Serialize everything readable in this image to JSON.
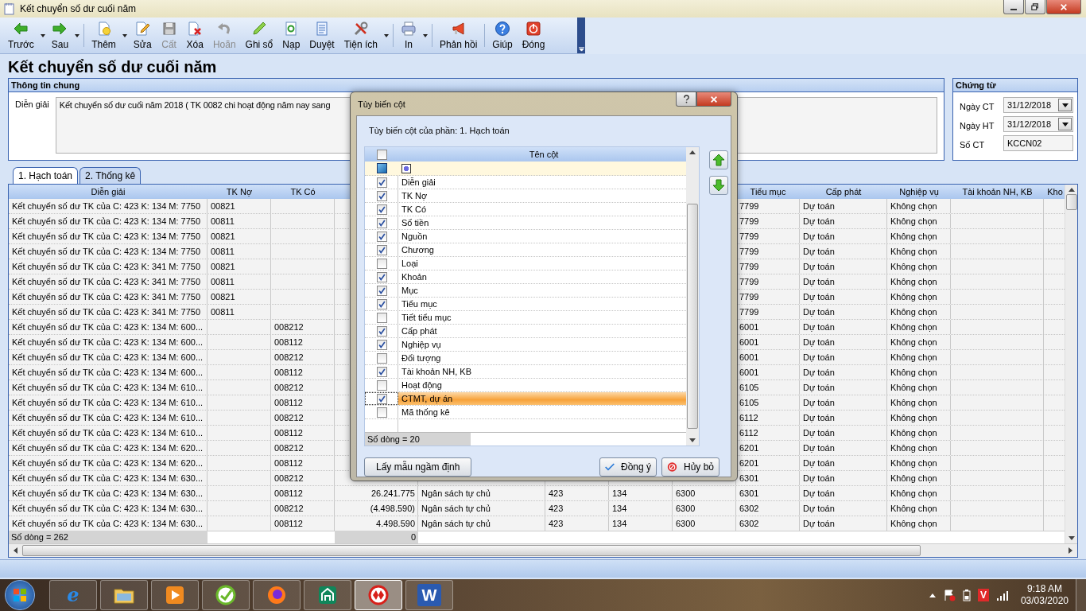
{
  "window": {
    "title": "Kết chuyển số dư cuối năm"
  },
  "toolbar": [
    [
      {
        "label": "Trước",
        "kind": "prev",
        "dropdown": true,
        "disabled": false
      },
      {
        "label": "Sau",
        "kind": "next",
        "dropdown": true,
        "disabled": false
      }
    ],
    [
      {
        "label": "Thêm",
        "kind": "add",
        "dropdown": true,
        "disabled": false
      },
      {
        "label": "Sửa",
        "kind": "edit",
        "dropdown": false,
        "disabled": false
      },
      {
        "label": "Cất",
        "kind": "save",
        "dropdown": false,
        "disabled": true
      },
      {
        "label": "Xóa",
        "kind": "delete",
        "dropdown": false,
        "disabled": false
      },
      {
        "label": "Hoãn",
        "kind": "undo",
        "dropdown": false,
        "disabled": true
      },
      {
        "label": "Ghi sổ",
        "kind": "post",
        "dropdown": false,
        "disabled": false
      },
      {
        "label": "Nạp",
        "kind": "reload",
        "dropdown": false,
        "disabled": false
      },
      {
        "label": "Duyệt",
        "kind": "approve",
        "dropdown": false,
        "disabled": false
      },
      {
        "label": "Tiện ích",
        "kind": "tools",
        "dropdown": true,
        "disabled": false
      }
    ],
    [
      {
        "label": "In",
        "kind": "print",
        "dropdown": true,
        "disabled": false
      }
    ],
    [
      {
        "label": "Phản hồi",
        "kind": "feedback",
        "dropdown": false,
        "disabled": false
      }
    ],
    [
      {
        "label": "Giúp",
        "kind": "help",
        "dropdown": false,
        "disabled": false
      },
      {
        "label": "Đóng",
        "kind": "close",
        "dropdown": false,
        "disabled": false
      }
    ]
  ],
  "page_title": "Kết chuyển số dư cuối năm",
  "general_info": {
    "title": "Thông tin chung",
    "label": "Diễn giải",
    "value": "Kết chuyển số dư cuối năm 2018 ( TK 0082 chi hoạt động năm nay sang"
  },
  "voucher": {
    "title": "Chứng từ",
    "fields": [
      {
        "label": "Ngày CT",
        "value": "31/12/2018",
        "kind": "date"
      },
      {
        "label": "Ngày HT",
        "value": "31/12/2018",
        "kind": "date"
      },
      {
        "label": "Số CT",
        "value": "KCCN02",
        "kind": "text"
      }
    ]
  },
  "tabs": [
    {
      "label": "1. Hạch toán",
      "selected": true
    },
    {
      "label": "2. Thống kê",
      "selected": false
    }
  ],
  "grid": {
    "columns": [
      "Diễn giải",
      "TK Nợ",
      "TK Có",
      null,
      null,
      null,
      null,
      null,
      "Tiểu mục",
      "Cấp phát",
      "Nghiệp vụ",
      "Tài khoản NH, KB",
      "Kho"
    ],
    "rows": [
      [
        "Kết chuyển số dư TK của C: 423 K: 134 M: 7750",
        "00821",
        null,
        null,
        null,
        null,
        null,
        null,
        "7799",
        "Dự toán",
        "Không chọn",
        null,
        null
      ],
      [
        "Kết chuyển số dư TK của C: 423 K: 134 M: 7750",
        "00811",
        null,
        null,
        null,
        null,
        null,
        null,
        "7799",
        "Dự toán",
        "Không chọn",
        null,
        null
      ],
      [
        "Kết chuyển số dư TK của C: 423 K: 134 M: 7750",
        "00821",
        null,
        null,
        null,
        null,
        null,
        null,
        "7799",
        "Dự toán",
        "Không chọn",
        null,
        null
      ],
      [
        "Kết chuyển số dư TK của C: 423 K: 134 M: 7750",
        "00811",
        null,
        null,
        null,
        null,
        null,
        null,
        "7799",
        "Dự toán",
        "Không chọn",
        null,
        null
      ],
      [
        "Kết chuyển số dư TK của C: 423 K: 341 M: 7750",
        "00821",
        null,
        null,
        null,
        null,
        null,
        null,
        "7799",
        "Dự toán",
        "Không chọn",
        null,
        null
      ],
      [
        "Kết chuyển số dư TK của C: 423 K: 341 M: 7750",
        "00811",
        null,
        null,
        null,
        null,
        null,
        null,
        "7799",
        "Dự toán",
        "Không chọn",
        null,
        null
      ],
      [
        "Kết chuyển số dư TK của C: 423 K: 341 M: 7750",
        "00821",
        null,
        null,
        null,
        null,
        null,
        null,
        "7799",
        "Dự toán",
        "Không chọn",
        null,
        null
      ],
      [
        "Kết chuyển số dư TK của C: 423 K: 341 M: 7750",
        "00811",
        null,
        null,
        null,
        null,
        null,
        null,
        "7799",
        "Dự toán",
        "Không chọn",
        null,
        null
      ],
      [
        "Kết chuyển số dư TK của C: 423 K: 134 M: 600...",
        null,
        "008212",
        null,
        null,
        null,
        null,
        null,
        "6001",
        "Dự toán",
        "Không chọn",
        null,
        null
      ],
      [
        "Kết chuyển số dư TK của C: 423 K: 134 M: 600...",
        null,
        "008112",
        null,
        null,
        null,
        null,
        null,
        "6001",
        "Dự toán",
        "Không chọn",
        null,
        null
      ],
      [
        "Kết chuyển số dư TK của C: 423 K: 134 M: 600...",
        null,
        "008212",
        null,
        null,
        null,
        null,
        null,
        "6001",
        "Dự toán",
        "Không chọn",
        null,
        null
      ],
      [
        "Kết chuyển số dư TK của C: 423 K: 134 M: 600...",
        null,
        "008112",
        null,
        null,
        null,
        null,
        null,
        "6001",
        "Dự toán",
        "Không chọn",
        null,
        null
      ],
      [
        "Kết chuyển số dư TK của C: 423 K: 134 M: 610...",
        null,
        "008212",
        null,
        null,
        null,
        null,
        null,
        "6105",
        "Dự toán",
        "Không chọn",
        null,
        null
      ],
      [
        "Kết chuyển số dư TK của C: 423 K: 134 M: 610...",
        null,
        "008112",
        null,
        null,
        null,
        null,
        null,
        "6105",
        "Dự toán",
        "Không chọn",
        null,
        null
      ],
      [
        "Kết chuyển số dư TK của C: 423 K: 134 M: 610...",
        null,
        "008212",
        null,
        null,
        null,
        null,
        null,
        "6112",
        "Dự toán",
        "Không chọn",
        null,
        null
      ],
      [
        "Kết chuyển số dư TK của C: 423 K: 134 M: 610...",
        null,
        "008112",
        null,
        null,
        null,
        null,
        null,
        "6112",
        "Dự toán",
        "Không chọn",
        null,
        null
      ],
      [
        "Kết chuyển số dư TK của C: 423 K: 134 M: 620...",
        null,
        "008212",
        null,
        null,
        null,
        null,
        null,
        "6201",
        "Dự toán",
        "Không chọn",
        null,
        null
      ],
      [
        "Kết chuyển số dư TK của C: 423 K: 134 M: 620...",
        null,
        "008112",
        null,
        null,
        null,
        null,
        null,
        "6201",
        "Dự toán",
        "Không chọn",
        null,
        null
      ],
      [
        "Kết chuyển số dư TK của C: 423 K: 134 M: 630...",
        null,
        "008212",
        null,
        null,
        null,
        null,
        null,
        "6301",
        "Dự toán",
        "Không chọn",
        null,
        null
      ],
      [
        "Kết chuyển số dư TK của C: 423 K: 134 M: 630...",
        null,
        "008112",
        "26.241.775",
        "Ngân sách tự chủ",
        "423",
        "134",
        "6300",
        "6301",
        "Dự toán",
        "Không chọn",
        null,
        null
      ],
      [
        "Kết chuyển số dư TK của C: 423 K: 134 M: 630...",
        null,
        "008212",
        "(4.498.590)",
        "Ngân sách tự chủ",
        "423",
        "134",
        "6300",
        "6302",
        "Dự toán",
        "Không chọn",
        null,
        null
      ],
      [
        "Kết chuyển số dư TK của C: 423 K: 134 M: 630...",
        null,
        "008112",
        "4.498.590",
        "Ngân sách tự chủ",
        "423",
        "134",
        "6300",
        "6302",
        "Dự toán",
        "Không chọn",
        null,
        null
      ]
    ],
    "row_count": "Số dòng = 262",
    "total": "0"
  },
  "dialog": {
    "title": "Tùy biến cột",
    "subtitle": "Tùy biến cột của phần: 1. Hạch toán",
    "list_header": "Tên cột",
    "header_checked": false,
    "filter_checked": true,
    "items": [
      {
        "label": "Diễn giải",
        "checked": true,
        "selected": false
      },
      {
        "label": "TK Nợ",
        "checked": true,
        "selected": false
      },
      {
        "label": "TK Có",
        "checked": true,
        "selected": false
      },
      {
        "label": "Số tiền",
        "checked": true,
        "selected": false
      },
      {
        "label": "Nguồn",
        "checked": true,
        "selected": false
      },
      {
        "label": "Chương",
        "checked": true,
        "selected": false
      },
      {
        "label": "Loại",
        "checked": false,
        "selected": false
      },
      {
        "label": "Khoản",
        "checked": true,
        "selected": false
      },
      {
        "label": "Mục",
        "checked": true,
        "selected": false
      },
      {
        "label": "Tiểu mục",
        "checked": true,
        "selected": false
      },
      {
        "label": "Tiết tiểu mục",
        "checked": false,
        "selected": false
      },
      {
        "label": "Cấp phát",
        "checked": true,
        "selected": false
      },
      {
        "label": "Nghiệp vụ",
        "checked": true,
        "selected": false
      },
      {
        "label": "Đối tượng",
        "checked": false,
        "selected": false
      },
      {
        "label": "Tài khoản NH, KB",
        "checked": true,
        "selected": false
      },
      {
        "label": "Hoạt động",
        "checked": false,
        "selected": false
      },
      {
        "label": "CTMT, dự án",
        "checked": true,
        "selected": true
      },
      {
        "label": "Mã thống kê",
        "checked": false,
        "selected": false
      }
    ],
    "row_count": "Số dòng = 20",
    "buttons": [
      {
        "label": "Lấy mẫu ngầm định",
        "kind": "plain"
      },
      {
        "label": "Đồng ý",
        "kind": "ok"
      },
      {
        "label": "Hủy bỏ",
        "kind": "cancel"
      }
    ]
  },
  "taskbar": {
    "apps": [
      {
        "kind": "ie",
        "letter": "e",
        "selected": false
      },
      {
        "kind": "folder",
        "selected": false
      },
      {
        "kind": "media",
        "selected": false
      },
      {
        "kind": "green",
        "selected": false
      },
      {
        "kind": "firefox",
        "selected": false
      },
      {
        "kind": "home",
        "selected": false
      },
      {
        "kind": "red",
        "selected": true
      },
      {
        "kind": "word",
        "letter": "W",
        "selected": false
      }
    ],
    "tray_badge": "V",
    "time": "9:18 AM",
    "date": "03/03/2020"
  }
}
